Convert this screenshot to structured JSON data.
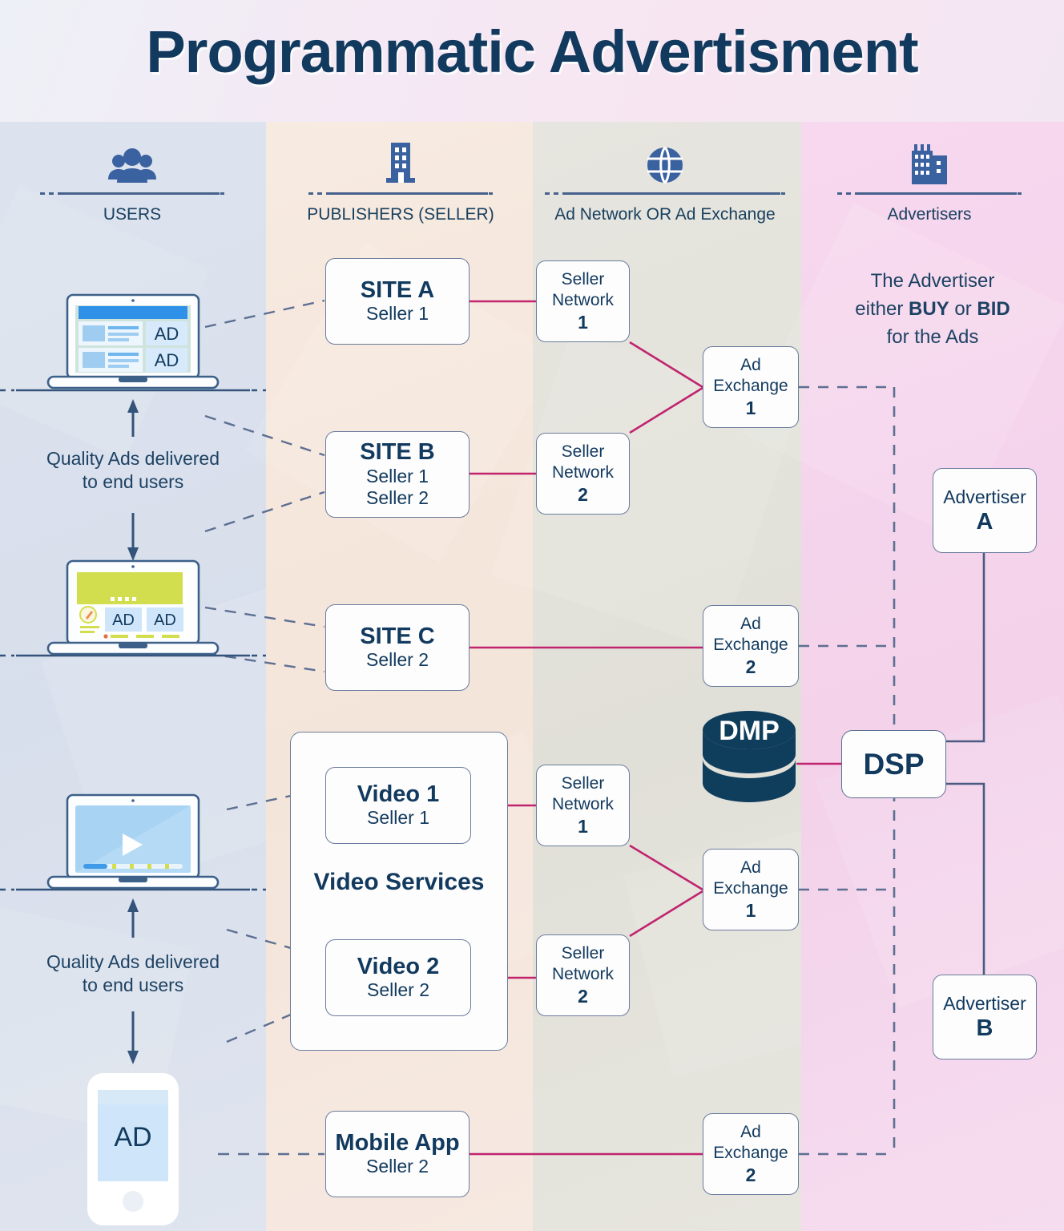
{
  "title": "Programmatic Advertisment",
  "colors": {
    "ink": "#123a5e",
    "magenta": "#c0246f",
    "dashed": "#5d6f92",
    "solid_link": "#4a5b83",
    "users_band": "#dde3ee",
    "publishers_band": "#f7eae0",
    "network_band": "#e6e5df",
    "advertisers_band": "#f7d8ef"
  },
  "columns": [
    {
      "id": "users",
      "label": "USERS",
      "icon": "people-icon"
    },
    {
      "id": "publishers",
      "label": "PUBLISHERS (SELLER)",
      "icon": "building-icon"
    },
    {
      "id": "network",
      "label": "Ad Network OR Ad Exchange",
      "icon": "globe-icon"
    },
    {
      "id": "advertisers",
      "label": "Advertisers",
      "icon": "city-icon"
    }
  ],
  "users_column": {
    "devices": [
      {
        "id": "laptop-article",
        "type": "laptop",
        "ad_labels": [
          "AD",
          "AD"
        ]
      },
      {
        "id": "laptop-banner",
        "type": "laptop",
        "ad_labels": [
          "AD",
          "AD"
        ]
      },
      {
        "id": "laptop-video",
        "type": "laptop",
        "ad_labels": []
      },
      {
        "id": "phone-ad",
        "type": "phone",
        "ad_labels": [
          "AD"
        ]
      }
    ],
    "notes": [
      {
        "id": "note-top",
        "line1": "Quality Ads delivered",
        "line2": "to end users"
      },
      {
        "id": "note-bottom",
        "line1": "Quality Ads delivered",
        "line2": "to end users"
      }
    ]
  },
  "publishers": [
    {
      "id": "site-a",
      "name": "SITE A",
      "sellers": [
        "Seller 1"
      ]
    },
    {
      "id": "site-b",
      "name": "SITE B",
      "sellers": [
        "Seller 1",
        "Seller 2"
      ]
    },
    {
      "id": "site-c",
      "name": "SITE C",
      "sellers": [
        "Seller 2"
      ]
    },
    {
      "id": "video-1",
      "name": "Video 1",
      "sellers": [
        "Seller 1"
      ]
    },
    {
      "id": "video-2",
      "name": "Video 2",
      "sellers": [
        "Seller 2"
      ]
    },
    {
      "id": "mobile-app",
      "name": "Mobile App",
      "sellers": [
        "Seller 2"
      ]
    }
  ],
  "video_services_label": "Video Services",
  "network_column": {
    "seller_networks": [
      {
        "id": "seller-network-1-top",
        "line1": "Seller",
        "line2": "Network",
        "num": "1"
      },
      {
        "id": "seller-network-2-top",
        "line1": "Seller",
        "line2": "Network",
        "num": "2"
      },
      {
        "id": "seller-network-1-bottom",
        "line1": "Seller",
        "line2": "Network",
        "num": "1"
      },
      {
        "id": "seller-network-2-bottom",
        "line1": "Seller",
        "line2": "Network",
        "num": "2"
      }
    ],
    "ad_exchanges": [
      {
        "id": "ad-exchange-1-top",
        "line1": "Ad",
        "line2": "Exchange",
        "num": "1"
      },
      {
        "id": "ad-exchange-2-mid",
        "line1": "Ad",
        "line2": "Exchange",
        "num": "2"
      },
      {
        "id": "ad-exchange-1-bottom",
        "line1": "Ad",
        "line2": "Exchange",
        "num": "1"
      },
      {
        "id": "ad-exchange-2-bottom",
        "line1": "Ad",
        "line2": "Exchange",
        "num": "2"
      }
    ],
    "dmp": {
      "id": "dmp",
      "label": "DMP"
    }
  },
  "advertisers_column": {
    "note": {
      "line1": "The Advertiser",
      "line2_pre": "either ",
      "line2_buy": "BUY",
      "line2_mid": " or ",
      "line2_bid": "BID",
      "line3": "for the Ads"
    },
    "dsp": {
      "label": "DSP"
    },
    "advertisers": [
      {
        "id": "advertiser-a",
        "line1": "Advertiser",
        "letter": "A"
      },
      {
        "id": "advertiser-b",
        "line1": "Advertiser",
        "letter": "B"
      }
    ]
  }
}
